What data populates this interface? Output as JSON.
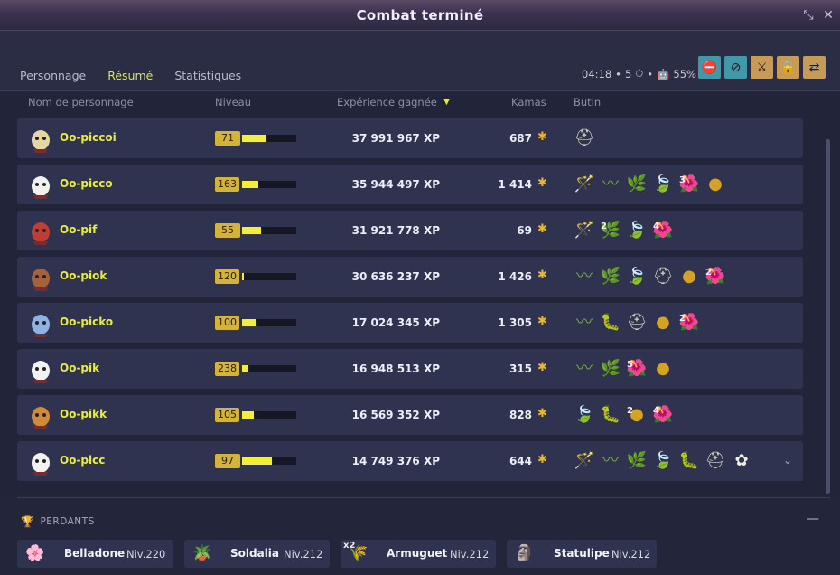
{
  "window": {
    "title": "Combat terminé"
  },
  "tabs": [
    {
      "label": "Personnage"
    },
    {
      "label": "Résumé"
    },
    {
      "label": "Statistiques"
    }
  ],
  "fight_info": {
    "time": "04:18",
    "dot1": "•",
    "turns": "5",
    "dot2": "•",
    "ratio": "55%"
  },
  "filters": [
    {
      "icon": "no-party-icon",
      "color": "#3f99a8"
    },
    {
      "icon": "no-spectator-icon",
      "color": "#3f99a8"
    },
    {
      "icon": "no-help-icon",
      "color": "#c79a55"
    },
    {
      "icon": "lock-fight-icon",
      "color": "#c79a55"
    },
    {
      "icon": "no-trade-icon",
      "color": "#c79a55"
    }
  ],
  "table": {
    "headers": {
      "name": "Nom de personnage",
      "level": "Niveau",
      "xp": "Expérience gagnée",
      "kamas": "Kamas",
      "loot": "Butin"
    },
    "rows": [
      {
        "name": "Oo-piccoi",
        "level": "71",
        "xp": "37 991 967 XP",
        "kamas": "687",
        "progress": 0.45,
        "loot": [
          {
            "icon": "helmet-icon",
            "qty": ""
          }
        ]
      },
      {
        "name": "Oo-picco",
        "level": "163",
        "xp": "35 944 497 XP",
        "kamas": "1 414",
        "progress": 0.3,
        "loot": [
          {
            "icon": "wand-icon",
            "qty": ""
          },
          {
            "icon": "worm-icon",
            "qty": ""
          },
          {
            "icon": "leaf-pack-icon",
            "qty": ""
          },
          {
            "icon": "green-leaf-icon",
            "qty": ""
          },
          {
            "icon": "red-flower-icon",
            "qty": "3"
          },
          {
            "icon": "gold-orb-icon",
            "qty": ""
          }
        ]
      },
      {
        "name": "Oo-pif",
        "level": "55",
        "xp": "31 921 778 XP",
        "kamas": "69",
        "progress": 0.35,
        "loot": [
          {
            "icon": "wand-icon",
            "qty": ""
          },
          {
            "icon": "leaf-pack-icon",
            "qty": "2"
          },
          {
            "icon": "green-leaf-icon",
            "qty": ""
          },
          {
            "icon": "red-flower-icon",
            "qty": "4"
          }
        ]
      },
      {
        "name": "Oo-piok",
        "level": "120",
        "xp": "30 636 237 XP",
        "kamas": "1 426",
        "progress": 0.03,
        "loot": [
          {
            "icon": "worm-icon",
            "qty": ""
          },
          {
            "icon": "leaf-pack-icon",
            "qty": ""
          },
          {
            "icon": "green-leaf-icon",
            "qty": ""
          },
          {
            "icon": "helmet-icon",
            "qty": ""
          },
          {
            "icon": "gold-orb-icon",
            "qty": ""
          },
          {
            "icon": "red-flower-icon",
            "qty": "2"
          }
        ]
      },
      {
        "name": "Oo-picko",
        "level": "100",
        "xp": "17 024 345 XP",
        "kamas": "1 305",
        "progress": 0.25,
        "loot": [
          {
            "icon": "worm-icon",
            "qty": ""
          },
          {
            "icon": "green-bug-icon",
            "qty": ""
          },
          {
            "icon": "helmet-icon",
            "qty": ""
          },
          {
            "icon": "gold-orb-icon",
            "qty": ""
          },
          {
            "icon": "red-flower-icon",
            "qty": "2"
          }
        ]
      },
      {
        "name": "Oo-pik",
        "level": "238",
        "xp": "16 948 513 XP",
        "kamas": "315",
        "progress": 0.12,
        "loot": [
          {
            "icon": "worm-icon",
            "qty": ""
          },
          {
            "icon": "leaf-pack-icon",
            "qty": ""
          },
          {
            "icon": "red-flower-icon",
            "qty": "5"
          },
          {
            "icon": "gold-orb-icon",
            "qty": ""
          }
        ]
      },
      {
        "name": "Oo-pikk",
        "level": "105",
        "xp": "16 569 352 XP",
        "kamas": "828",
        "progress": 0.22,
        "loot": [
          {
            "icon": "green-leaf-icon",
            "qty": ""
          },
          {
            "icon": "green-bug-icon",
            "qty": ""
          },
          {
            "icon": "gold-orb-icon",
            "qty": "2"
          },
          {
            "icon": "red-flower-icon",
            "qty": "4"
          }
        ]
      },
      {
        "name": "Oo-picc",
        "level": "97",
        "xp": "14 749 376 XP",
        "kamas": "644",
        "progress": 0.55,
        "loot": [
          {
            "icon": "wand-icon",
            "qty": ""
          },
          {
            "icon": "worm-icon",
            "qty": ""
          },
          {
            "icon": "leaf-pack-icon",
            "qty": ""
          },
          {
            "icon": "green-leaf-icon",
            "qty": ""
          },
          {
            "icon": "green-bug-icon",
            "qty": ""
          },
          {
            "icon": "helmet-icon",
            "qty": ""
          },
          {
            "icon": "white-flower-icon",
            "qty": ""
          }
        ]
      }
    ]
  },
  "losers": {
    "heading": "PERDANTS",
    "monsters": [
      {
        "name": "Belladone",
        "level": "Niv.220",
        "qty": ""
      },
      {
        "name": "Soldalia",
        "level": "Niv.212",
        "qty": ""
      },
      {
        "name": "Armuguet",
        "level": "Niv.212",
        "qty": "x2"
      },
      {
        "name": "Statulipe",
        "level": "Niv.212",
        "qty": ""
      }
    ]
  }
}
